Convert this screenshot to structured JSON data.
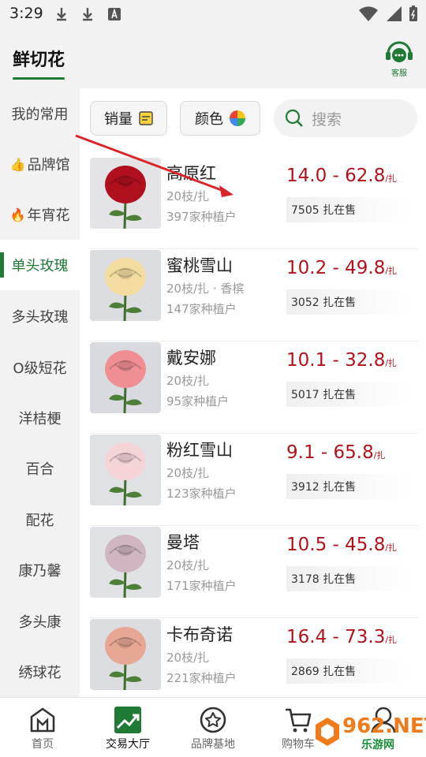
{
  "status": {
    "time": "3:29"
  },
  "header": {
    "title": "鲜切花",
    "service_label": "客服"
  },
  "sidebar": {
    "items": [
      {
        "label": "我的常用",
        "emoji": ""
      },
      {
        "label": "品牌馆",
        "emoji": "👍"
      },
      {
        "label": "年宵花",
        "emoji": "🔥"
      },
      {
        "label": "单头玫瑰",
        "emoji": "",
        "active": true
      },
      {
        "label": "多头玫瑰",
        "emoji": ""
      },
      {
        "label": "O级短花",
        "emoji": ""
      },
      {
        "label": "洋桔梗",
        "emoji": ""
      },
      {
        "label": "百合",
        "emoji": ""
      },
      {
        "label": "配花",
        "emoji": ""
      },
      {
        "label": "康乃馨",
        "emoji": ""
      },
      {
        "label": "多头康",
        "emoji": ""
      },
      {
        "label": "绣球花",
        "emoji": ""
      }
    ]
  },
  "filters": {
    "sales_label": "销量",
    "color_label": "颜色",
    "search_placeholder": "搜索"
  },
  "products": [
    {
      "name": "高原红",
      "spec": "20枝/扎",
      "growers": "397家种植户",
      "price": "14.0 - 62.8",
      "unit": "/扎",
      "stock": "7505 扎在售",
      "color": "#b0101e",
      "bg": "#e4e4e6"
    },
    {
      "name": "蜜桃雪山",
      "spec": "20枝/扎 · 香槟",
      "growers": "147家种植户",
      "price": "10.2 - 49.8",
      "unit": "/扎",
      "stock": "3052 扎在售",
      "color": "#f3dca0",
      "bg": "#dcdde0"
    },
    {
      "name": "戴安娜",
      "spec": "20枝/扎",
      "growers": "95家种植户",
      "price": "10.1 - 32.8",
      "unit": "/扎",
      "stock": "5017 扎在售",
      "color": "#ef8f94",
      "bg": "#d8dadf"
    },
    {
      "name": "粉红雪山",
      "spec": "20枝/扎",
      "growers": "123家种植户",
      "price": "9.1 - 65.8",
      "unit": "/扎",
      "stock": "3912 扎在售",
      "color": "#f5d4d8",
      "bg": "#e0e1e4"
    },
    {
      "name": "曼塔",
      "spec": "20枝/扎",
      "growers": "171家种植户",
      "price": "10.5 - 45.8",
      "unit": "/扎",
      "stock": "3178 扎在售",
      "color": "#cfb6c2",
      "bg": "#e1e2e5"
    },
    {
      "name": "卡布奇诺",
      "spec": "20枝/扎",
      "growers": "221家种植户",
      "price": "16.4 - 73.3",
      "unit": "/扎",
      "stock": "2869 扎在售",
      "color": "#e6a794",
      "bg": "#dcdde0"
    }
  ],
  "bottom_nav": [
    {
      "label": "首页",
      "icon": "home-icon"
    },
    {
      "label": "交易大厅",
      "icon": "trade-chart-icon",
      "active": true
    },
    {
      "label": "品牌基地",
      "icon": "brand-star-icon"
    },
    {
      "label": "购物车",
      "icon": "cart-icon"
    },
    {
      "label": "",
      "icon": "profile-icon"
    }
  ],
  "watermark": {
    "text": "962.NET",
    "sub": "乐游网"
  }
}
